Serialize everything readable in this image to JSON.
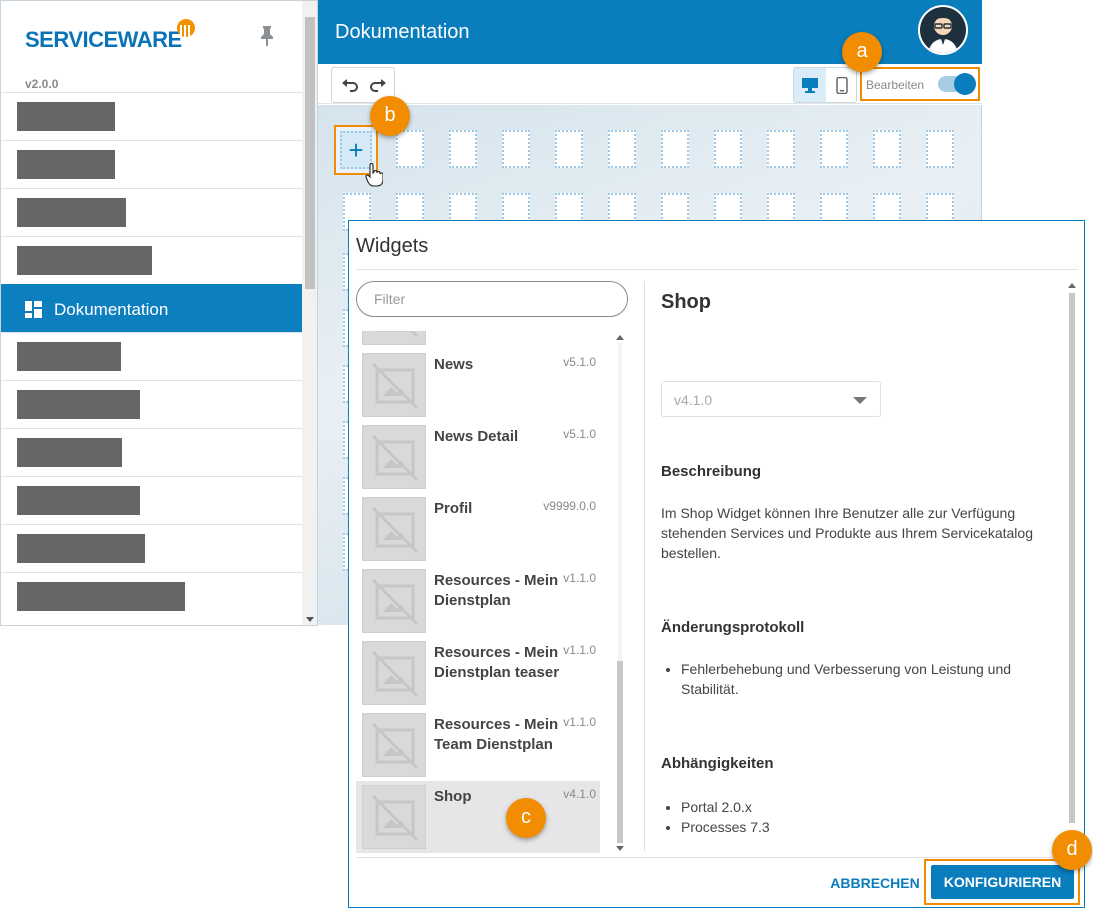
{
  "sidebar": {
    "logo_text": "SERVICEWARE",
    "version": "v2.0.0",
    "active_item": "Dokumentation"
  },
  "header": {
    "title": "Dokumentation"
  },
  "toolbar": {
    "edit_label": "Bearbeiten",
    "edit_enabled": true
  },
  "dialog": {
    "title": "Widgets",
    "filter_placeholder": "Filter",
    "widgets": [
      {
        "name": "News",
        "version": "v5.1.0"
      },
      {
        "name": "News Detail",
        "version": "v5.1.0"
      },
      {
        "name": "Profil",
        "version": "v9999.0.0"
      },
      {
        "name": "Resources - Mein Dienstplan",
        "version": "v1.1.0"
      },
      {
        "name": "Resources - Mein Dienstplan teaser",
        "version": "v1.1.0"
      },
      {
        "name": "Resources - Mein Team Dienstplan",
        "version": "v1.1.0"
      },
      {
        "name": "Shop",
        "version": "v4.1.0"
      }
    ],
    "detail": {
      "title": "Shop",
      "version_select": "v4.1.0",
      "description_heading": "Beschreibung",
      "description": "Im Shop Widget können Ihre Benutzer alle zur Verfügung stehenden Services und Produkte aus Ihrem Servicekatalog bestellen.",
      "changelog_heading": "Änderungsprotokoll",
      "changelog": [
        "Fehlerbehebung und Verbesserung von Leistung und Stabilität."
      ],
      "dependencies_heading": "Abhängigkeiten",
      "dependencies": [
        "Portal 2.0.x",
        "Processes 7.3"
      ]
    },
    "cancel_label": "ABBRECHEN",
    "configure_label": "KONFIGURIEREN"
  },
  "callouts": {
    "a": "a",
    "b": "b",
    "c": "c",
    "d": "d"
  },
  "colors": {
    "brand_blue": "#0a7dbd",
    "callout_orange": "#f28c00"
  }
}
